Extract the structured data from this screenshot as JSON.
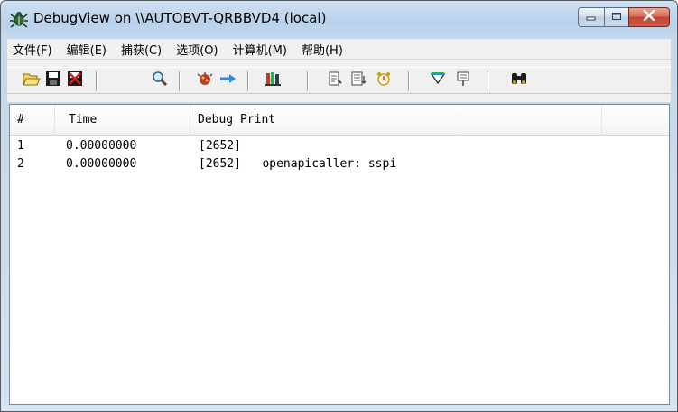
{
  "window": {
    "title": "DebugView on \\\\AUTOBVT-QRBBVD4 (local)"
  },
  "menu": {
    "items": [
      "文件(F)",
      "编辑(E)",
      "捕获(C)",
      "选项(O)",
      "计算机(M)",
      "帮助(H)"
    ]
  },
  "toolbar": {
    "buttons": [
      "open-icon",
      "save-icon",
      "clear-icon",
      "find-icon",
      "capture-icon",
      "autoscroll-icon",
      "highlight-icon",
      "history-icon",
      "time-format-icon",
      "clock-icon",
      "filter-icon",
      "pin-icon",
      "binoculars-icon"
    ]
  },
  "list": {
    "columns": [
      "#",
      "Time",
      "Debug Print"
    ],
    "rows": [
      {
        "num": "1",
        "time": "0.00000000",
        "print": "[2652]"
      },
      {
        "num": "2",
        "time": "0.00000000",
        "print": "[2652]   openapicaller: sspi"
      }
    ]
  },
  "colors": {
    "title_bar": "#b9d1ea",
    "close_button": "#c0432c",
    "menu_bg": "#f0f0f0"
  }
}
